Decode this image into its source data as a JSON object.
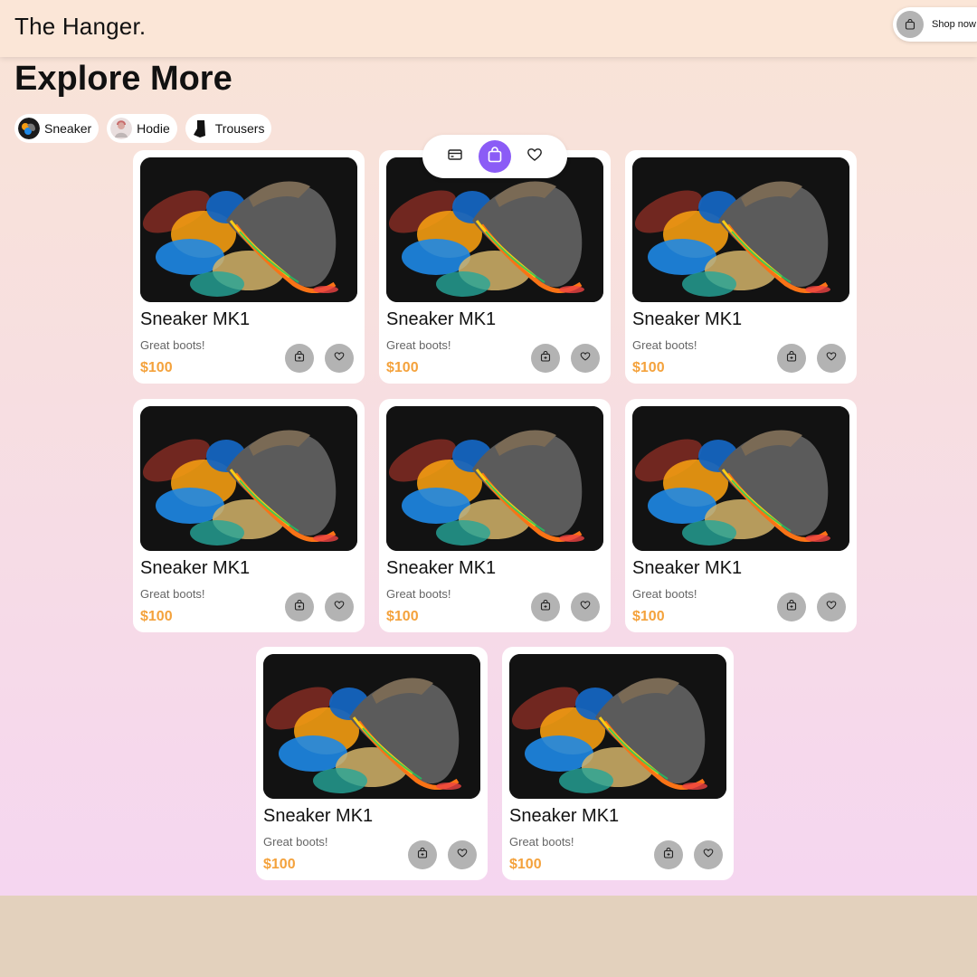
{
  "header": {
    "brand": "The Hanger.",
    "shop_now": {
      "label": "Shop now",
      "icon": "bag-icon"
    }
  },
  "main": {
    "title": "Explore More",
    "categories": [
      {
        "label": "Sneaker",
        "thumb": "sneaker-thumb"
      },
      {
        "label": "Hodie",
        "thumb": "hoodie-thumb"
      },
      {
        "label": "Trousers",
        "thumb": "trousers-thumb"
      }
    ]
  },
  "floating_bar": {
    "items": [
      {
        "icon": "card-icon",
        "active": false
      },
      {
        "icon": "bag-icon",
        "active": true
      },
      {
        "icon": "heart-icon",
        "active": false
      }
    ]
  },
  "products": [
    {
      "name": "Sneaker MK1",
      "desc": "Great boots!",
      "price": "$100"
    },
    {
      "name": "Sneaker MK1",
      "desc": "Great boots!",
      "price": "$100"
    },
    {
      "name": "Sneaker MK1",
      "desc": "Great boots!",
      "price": "$100"
    },
    {
      "name": "Sneaker MK1",
      "desc": "Great boots!",
      "price": "$100"
    },
    {
      "name": "Sneaker MK1",
      "desc": "Great boots!",
      "price": "$100"
    },
    {
      "name": "Sneaker MK1",
      "desc": "Great boots!",
      "price": "$100"
    },
    {
      "name": "Sneaker MK1",
      "desc": "Great boots!",
      "price": "$100"
    },
    {
      "name": "Sneaker MK1",
      "desc": "Great boots!",
      "price": "$100"
    }
  ],
  "colors": {
    "accent": "#8b5cf6",
    "price": "#f4a23c",
    "icon_button": "#b3b3b3"
  }
}
